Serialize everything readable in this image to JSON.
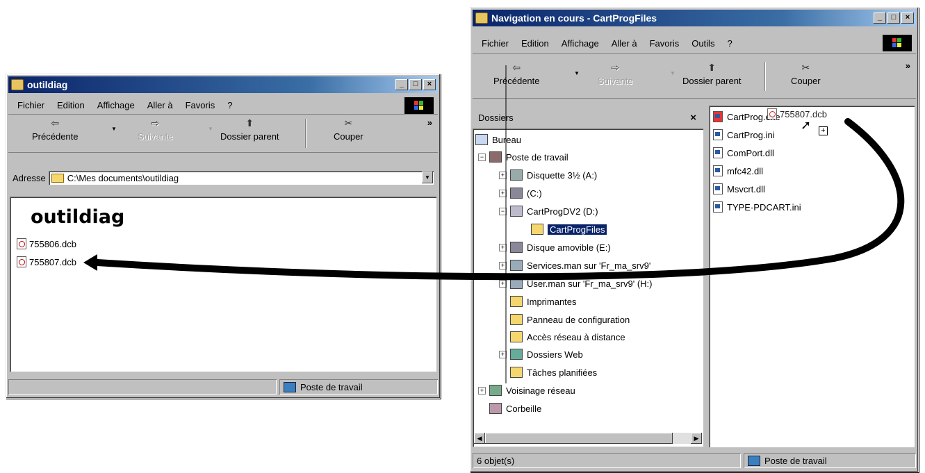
{
  "left_window": {
    "title": "outildiag",
    "menu": [
      "Fichier",
      "Edition",
      "Affichage",
      "Aller à",
      "Favoris",
      "?"
    ],
    "toolbar": {
      "back": "Précédente",
      "forward": "Suivante",
      "up": "Dossier parent",
      "cut": "Couper",
      "more": "»"
    },
    "address": {
      "label": "Adresse",
      "value": "C:\\Mes documents\\outildiag"
    },
    "folder_heading": "outildiag",
    "files": [
      "755806.dcb",
      "755807.dcb"
    ],
    "status": {
      "right": "Poste de travail"
    }
  },
  "right_window": {
    "title": "Navigation en cours - CartProgFiles",
    "menu": [
      "Fichier",
      "Edition",
      "Affichage",
      "Aller à",
      "Favoris",
      "Outils",
      "?"
    ],
    "toolbar": {
      "back": "Précédente",
      "forward": "Suivante",
      "up": "Dossier parent",
      "cut": "Couper",
      "more": "»"
    },
    "folders_pane": {
      "title": "Dossiers",
      "close": "×",
      "items": [
        "Bureau",
        "Poste de travail",
        "Disquette 3½ (A:)",
        "(C:)",
        "CartProgDV2 (D:)",
        "CartProgFiles",
        "Disque amovible (E:)",
        "Services.man sur 'Fr_ma_srv9'",
        "User.man sur 'Fr_ma_srv9' (H:)",
        "Imprimantes",
        "Panneau de configuration",
        "Accès réseau à distance",
        "Dossiers Web",
        "Tâches planifiées",
        "Voisinage réseau",
        "Corbeille"
      ]
    },
    "files": [
      "CartProg.exe",
      "CartProg.ini",
      "ComPort.dll",
      "mfc42.dll",
      "Msvcrt.dll",
      "TYPE-PDCART.ini"
    ],
    "dragged_file": "755807.dcb",
    "status": {
      "left": "6 objet(s)",
      "right": "Poste de travail"
    }
  }
}
